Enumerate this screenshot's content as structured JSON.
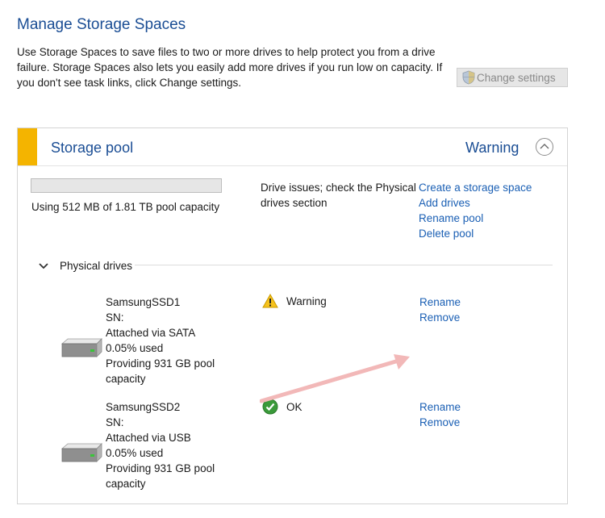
{
  "page": {
    "title": "Manage Storage Spaces",
    "intro": "Use Storage Spaces to save files to two or more drives to help protect you from a drive failure. Storage Spaces also lets you easily add more drives if you run low on capacity. If you don't see task links, click Change settings.",
    "change_settings_label": "Change settings"
  },
  "pool": {
    "title": "Storage pool",
    "status": "Warning",
    "capacity_text": "Using 512 MB of 1.81 TB pool capacity",
    "capacity_used_fraction": 0.0003,
    "issue_text": "Drive issues; check the Physical drives section",
    "tasks": [
      "Create a storage space",
      "Add drives",
      "Rename pool",
      "Delete pool"
    ]
  },
  "physical_drives": {
    "label": "Physical drives",
    "drives": [
      {
        "name": "SamsungSSD1",
        "sn": "SN:",
        "attached": "Attached via SATA",
        "used": "0.05% used",
        "providing": "Providing 931 GB pool",
        "providing2": "capacity",
        "status": "Warning",
        "status_icon": "warning-icon",
        "actions": [
          "Rename",
          "Remove"
        ]
      },
      {
        "name": "SamsungSSD2",
        "sn": "SN:",
        "attached": "Attached via USB",
        "used": "0.05% used",
        "providing": "Providing 931 GB pool",
        "providing2": "capacity",
        "status": "OK",
        "status_icon": "ok-check-icon",
        "actions": [
          "Rename",
          "Remove"
        ]
      }
    ]
  },
  "colors": {
    "title_blue": "#1a4d94",
    "link_blue": "#1a5fb4",
    "warning_accent": "#f4b400",
    "ok_green": "#3a9a3a",
    "annotation_arrow": "#f2b8b8"
  }
}
